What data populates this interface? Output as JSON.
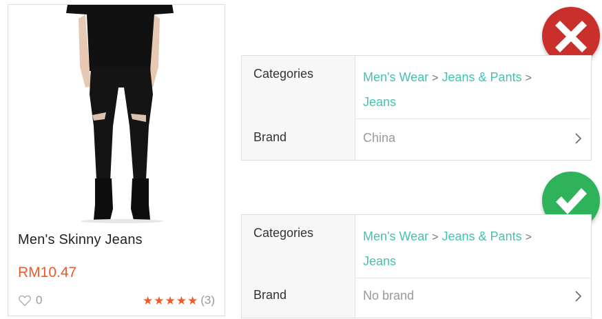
{
  "product": {
    "name": "Men's Skinny Jeans",
    "price": "RM10.47",
    "likes": "0",
    "rating": 5,
    "rating_count": "(3)"
  },
  "incorrect_example": {
    "categories_label": "Categories",
    "categories": [
      "Men's Wear",
      "Jeans & Pants",
      "Jeans"
    ],
    "brand_label": "Brand",
    "brand_value": "China"
  },
  "correct_example": {
    "categories_label": "Categories",
    "categories": [
      "Men's Wear",
      "Jeans & Pants",
      "Jeans"
    ],
    "brand_label": "Brand",
    "brand_value": "No brand"
  },
  "separator": ">",
  "icons": {
    "wrong_badge": "cross-icon",
    "right_badge": "check-icon",
    "chevron": "chevron-right-icon",
    "heart": "heart-icon",
    "star": "star-icon"
  },
  "colors": {
    "price": "#f05a28",
    "category_link": "#44c2b0",
    "wrong": "#c9302c",
    "right": "#2fb35a"
  }
}
